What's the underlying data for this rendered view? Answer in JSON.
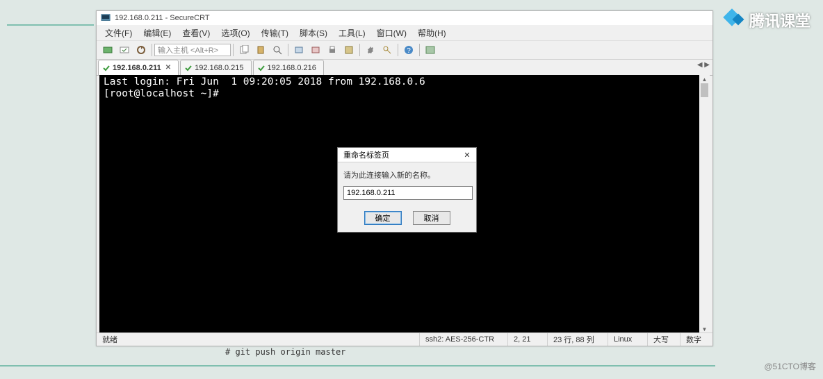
{
  "window": {
    "title": "192.168.0.211 - SecureCRT"
  },
  "menu": {
    "file": "文件(F)",
    "edit": "编辑(E)",
    "view": "查看(V)",
    "options": "选项(O)",
    "transfer": "传输(T)",
    "script": "脚本(S)",
    "tools": "工具(L)",
    "window": "窗口(W)",
    "help": "帮助(H)"
  },
  "toolbar": {
    "host_placeholder": "输入主机 <Alt+R>"
  },
  "tabs": {
    "items": [
      {
        "label": "192.168.0.211",
        "active": true,
        "closable": true
      },
      {
        "label": "192.168.0.215",
        "active": false,
        "closable": false
      },
      {
        "label": "192.168.0.216",
        "active": false,
        "closable": false
      }
    ]
  },
  "terminal": {
    "line1": "Last login: Fri Jun  1 09:20:05 2018 from 192.168.0.6",
    "line2": "[root@localhost ~]#"
  },
  "status": {
    "ready": "就绪",
    "proto": "ssh2: AES-256-CTR",
    "cursor": "2, 21",
    "size": "23 行, 88 列",
    "os": "Linux",
    "caps": "大写",
    "num": "数字"
  },
  "dialog": {
    "title": "重命名标签页",
    "message": "请为此连接输入新的名称。",
    "value": "192.168.0.211",
    "ok": "确定",
    "cancel": "取消"
  },
  "caption": "# git push origin master",
  "brand": "腾讯课堂",
  "credit": "@51CTO博客"
}
